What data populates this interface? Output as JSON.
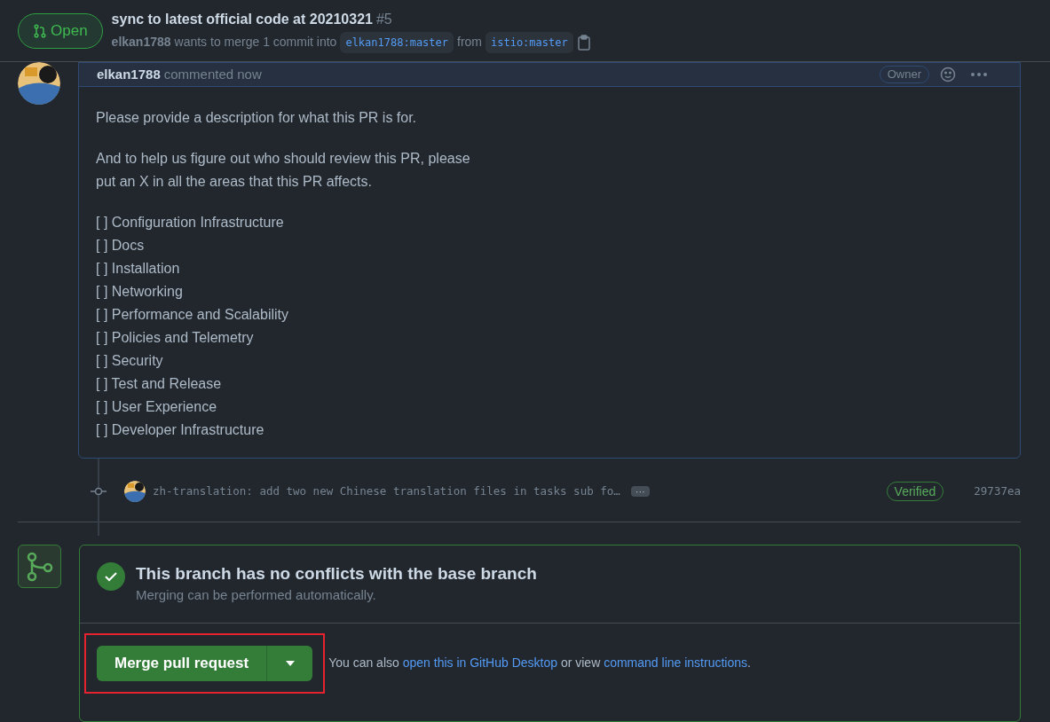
{
  "header": {
    "state": {
      "label": "Open",
      "kind": "open"
    },
    "title": "sync to latest official code at 20210321",
    "number": "#5",
    "author": "elkan1788",
    "merge_text": "wants to merge 1 commit into",
    "base_branch": "elkan1788:master",
    "from_text": "from",
    "head_branch": "istio:master"
  },
  "comment": {
    "author": "elkan1788",
    "action": "commented now",
    "role": "Owner",
    "paragraphs": [
      "Please provide a description for what this PR is for.",
      "And to help us figure out who should review this PR, please\nput an X in all the areas that this PR affects."
    ],
    "checklist": [
      "[ ] Configuration Infrastructure",
      "[ ] Docs",
      "[ ] Installation",
      "[ ] Networking",
      "[ ] Performance and Scalability",
      "[ ] Policies and Telemetry",
      "[ ] Security",
      "[ ] Test and Release",
      "[ ] User Experience",
      "[ ] Developer Infrastructure"
    ]
  },
  "commit": {
    "message": "zh-translation: add two new Chinese translation files in tasks sub fo…",
    "expand": "···",
    "badge": "Verified",
    "sha": "29737ea"
  },
  "merge": {
    "title": "This branch has no conflicts with the base branch",
    "subtitle": "Merging can be performed automatically.",
    "button": "Merge pull request",
    "note_prefix": "You can also",
    "link1": "open this in GitHub Desktop",
    "note_middle": "or view",
    "link2": "command line instructions",
    "note_suffix": "."
  }
}
